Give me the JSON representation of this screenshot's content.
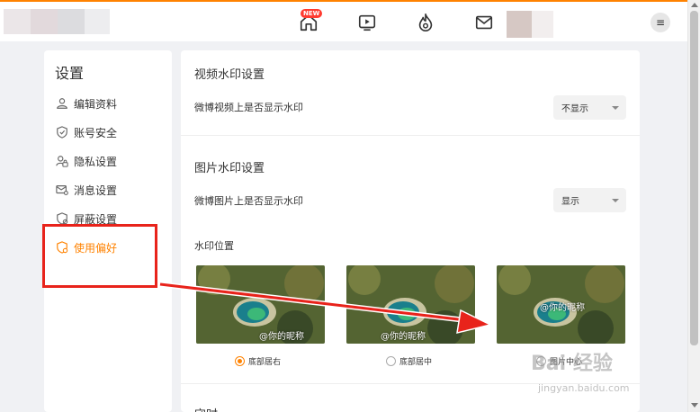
{
  "header": {
    "nav": [
      {
        "name": "home",
        "badge": "NEW"
      },
      {
        "name": "video"
      },
      {
        "name": "hot"
      },
      {
        "name": "messages"
      }
    ],
    "menu_icon": "≡"
  },
  "sidebar": {
    "title": "设置",
    "items": [
      {
        "label": "编辑资料",
        "icon": "user-icon"
      },
      {
        "label": "账号安全",
        "icon": "shield-icon"
      },
      {
        "label": "隐私设置",
        "icon": "lock-user-icon"
      },
      {
        "label": "消息设置",
        "icon": "mail-gear-icon"
      },
      {
        "label": "屏蔽设置",
        "icon": "block-icon"
      },
      {
        "label": "使用偏好",
        "icon": "preference-icon",
        "active": true
      }
    ]
  },
  "main": {
    "video_watermark": {
      "title": "视频水印设置",
      "row_label": "微博视频上是否显示水印",
      "select_value": "不显示"
    },
    "image_watermark": {
      "title": "图片水印设置",
      "row_label": "微博图片上是否显示水印",
      "select_value": "显示"
    },
    "position": {
      "label": "水印位置",
      "options": [
        {
          "label": "底部居右",
          "watermark_text": "@你的昵称",
          "checked": true
        },
        {
          "label": "底部居中",
          "watermark_text": "@你的昵称",
          "checked": false
        },
        {
          "label": "图片中心",
          "watermark_text": "@你的昵称",
          "checked": false
        }
      ]
    },
    "next_section_partial": "守时"
  },
  "overlay": {
    "watermark_logo": "Bai 经验",
    "watermark_url": "jingyan.baidu.com"
  },
  "colors": {
    "accent": "#ff8200",
    "annotation_red": "#e8231b"
  }
}
